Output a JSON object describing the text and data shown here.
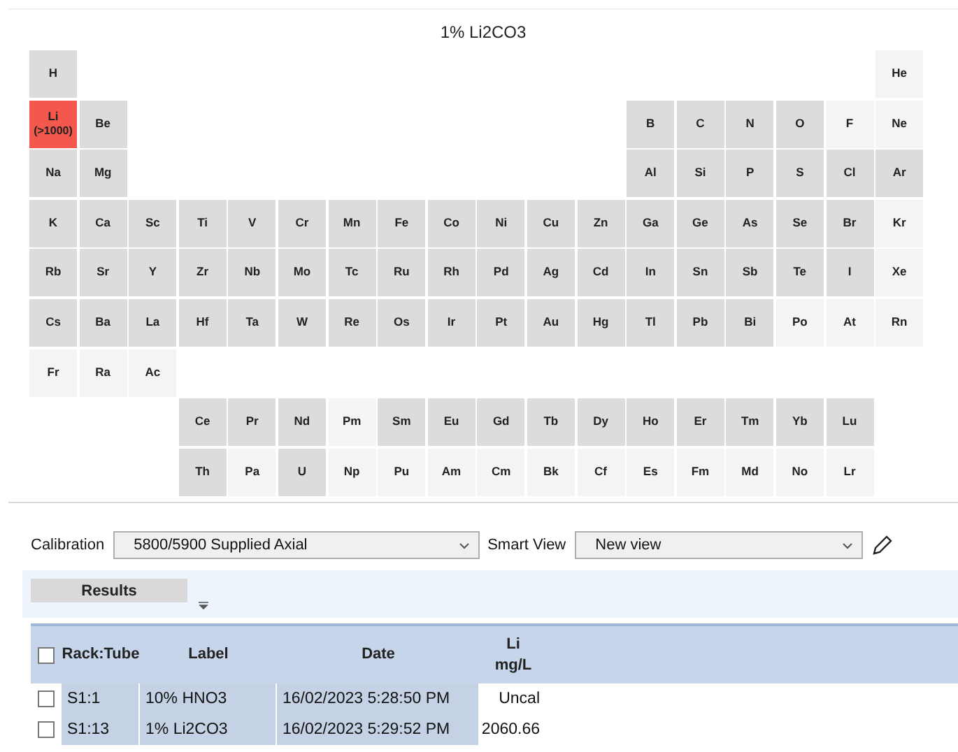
{
  "periodic_table": {
    "title": "1% Li2CO3",
    "elements": [
      {
        "symbol": "H",
        "color": "#dcdcdc"
      },
      {
        "symbol": "He",
        "color": "#f4f4f4"
      },
      {
        "symbol": "Li",
        "color": "#f4574b",
        "note": "(>1000)"
      },
      {
        "symbol": "Be",
        "color": "#dcdcdc"
      },
      {
        "symbol": "B",
        "color": "#dcdcdc"
      },
      {
        "symbol": "C",
        "color": "#dcdcdc"
      },
      {
        "symbol": "N",
        "color": "#dcdcdc"
      },
      {
        "symbol": "O",
        "color": "#dcdcdc"
      },
      {
        "symbol": "F",
        "color": "#f4f4f4"
      },
      {
        "symbol": "Ne",
        "color": "#f4f4f4"
      },
      {
        "symbol": "Na",
        "color": "#dcdcdc"
      },
      {
        "symbol": "Mg",
        "color": "#dcdcdc"
      },
      {
        "symbol": "Al",
        "color": "#dcdcdc"
      },
      {
        "symbol": "Si",
        "color": "#dcdcdc"
      },
      {
        "symbol": "P",
        "color": "#dcdcdc"
      },
      {
        "symbol": "S",
        "color": "#dcdcdc"
      },
      {
        "symbol": "Cl",
        "color": "#dcdcdc"
      },
      {
        "symbol": "Ar",
        "color": "#dcdcdc"
      },
      {
        "symbol": "K",
        "color": "#dcdcdc"
      },
      {
        "symbol": "Ca",
        "color": "#dcdcdc"
      },
      {
        "symbol": "Sc",
        "color": "#dcdcdc"
      },
      {
        "symbol": "Ti",
        "color": "#dcdcdc"
      },
      {
        "symbol": "V",
        "color": "#dcdcdc"
      },
      {
        "symbol": "Cr",
        "color": "#dcdcdc"
      },
      {
        "symbol": "Mn",
        "color": "#dcdcdc"
      },
      {
        "symbol": "Fe",
        "color": "#dcdcdc"
      },
      {
        "symbol": "Co",
        "color": "#dcdcdc"
      },
      {
        "symbol": "Ni",
        "color": "#dcdcdc"
      },
      {
        "symbol": "Cu",
        "color": "#dcdcdc"
      },
      {
        "symbol": "Zn",
        "color": "#dcdcdc"
      },
      {
        "symbol": "Ga",
        "color": "#dcdcdc"
      },
      {
        "symbol": "Ge",
        "color": "#dcdcdc"
      },
      {
        "symbol": "As",
        "color": "#dcdcdc"
      },
      {
        "symbol": "Se",
        "color": "#dcdcdc"
      },
      {
        "symbol": "Br",
        "color": "#dcdcdc"
      },
      {
        "symbol": "Kr",
        "color": "#f4f4f4"
      },
      {
        "symbol": "Rb",
        "color": "#dcdcdc"
      },
      {
        "symbol": "Sr",
        "color": "#dcdcdc"
      },
      {
        "symbol": "Y",
        "color": "#dcdcdc"
      },
      {
        "symbol": "Zr",
        "color": "#dcdcdc"
      },
      {
        "symbol": "Nb",
        "color": "#dcdcdc"
      },
      {
        "symbol": "Mo",
        "color": "#dcdcdc"
      },
      {
        "symbol": "Tc",
        "color": "#dcdcdc"
      },
      {
        "symbol": "Ru",
        "color": "#dcdcdc"
      },
      {
        "symbol": "Rh",
        "color": "#dcdcdc"
      },
      {
        "symbol": "Pd",
        "color": "#dcdcdc"
      },
      {
        "symbol": "Ag",
        "color": "#dcdcdc"
      },
      {
        "symbol": "Cd",
        "color": "#dcdcdc"
      },
      {
        "symbol": "In",
        "color": "#dcdcdc"
      },
      {
        "symbol": "Sn",
        "color": "#dcdcdc"
      },
      {
        "symbol": "Sb",
        "color": "#dcdcdc"
      },
      {
        "symbol": "Te",
        "color": "#dcdcdc"
      },
      {
        "symbol": "I",
        "color": "#dcdcdc"
      },
      {
        "symbol": "Xe",
        "color": "#f4f4f4"
      },
      {
        "symbol": "Cs",
        "color": "#dcdcdc"
      },
      {
        "symbol": "Ba",
        "color": "#dcdcdc"
      },
      {
        "symbol": "La",
        "color": "#dcdcdc"
      },
      {
        "symbol": "Hf",
        "color": "#dcdcdc"
      },
      {
        "symbol": "Ta",
        "color": "#dcdcdc"
      },
      {
        "symbol": "W",
        "color": "#dcdcdc"
      },
      {
        "symbol": "Re",
        "color": "#dcdcdc"
      },
      {
        "symbol": "Os",
        "color": "#dcdcdc"
      },
      {
        "symbol": "Ir",
        "color": "#dcdcdc"
      },
      {
        "symbol": "Pt",
        "color": "#dcdcdc"
      },
      {
        "symbol": "Au",
        "color": "#dcdcdc"
      },
      {
        "symbol": "Hg",
        "color": "#dcdcdc"
      },
      {
        "symbol": "Tl",
        "color": "#dcdcdc"
      },
      {
        "symbol": "Pb",
        "color": "#dcdcdc"
      },
      {
        "symbol": "Bi",
        "color": "#dcdcdc"
      },
      {
        "symbol": "Po",
        "color": "#f4f4f4"
      },
      {
        "symbol": "At",
        "color": "#f4f4f4"
      },
      {
        "symbol": "Rn",
        "color": "#f4f4f4"
      },
      {
        "symbol": "Fr",
        "color": "#f4f4f4"
      },
      {
        "symbol": "Ra",
        "color": "#f4f4f4"
      },
      {
        "symbol": "Ac",
        "color": "#f4f4f4"
      },
      {
        "symbol": "Ce",
        "color": "#dcdcdc"
      },
      {
        "symbol": "Pr",
        "color": "#dcdcdc"
      },
      {
        "symbol": "Nd",
        "color": "#dcdcdc"
      },
      {
        "symbol": "Pm",
        "color": "#f4f4f4"
      },
      {
        "symbol": "Sm",
        "color": "#dcdcdc"
      },
      {
        "symbol": "Eu",
        "color": "#dcdcdc"
      },
      {
        "symbol": "Gd",
        "color": "#dcdcdc"
      },
      {
        "symbol": "Tb",
        "color": "#dcdcdc"
      },
      {
        "symbol": "Dy",
        "color": "#dcdcdc"
      },
      {
        "symbol": "Ho",
        "color": "#dcdcdc"
      },
      {
        "symbol": "Er",
        "color": "#dcdcdc"
      },
      {
        "symbol": "Tm",
        "color": "#dcdcdc"
      },
      {
        "symbol": "Yb",
        "color": "#dcdcdc"
      },
      {
        "symbol": "Lu",
        "color": "#dcdcdc"
      },
      {
        "symbol": "Th",
        "color": "#dcdcdc"
      },
      {
        "symbol": "Pa",
        "color": "#f4f4f4"
      },
      {
        "symbol": "U",
        "color": "#dcdcdc"
      },
      {
        "symbol": "Np",
        "color": "#f4f4f4"
      },
      {
        "symbol": "Pu",
        "color": "#f4f4f4"
      },
      {
        "symbol": "Am",
        "color": "#f4f4f4"
      },
      {
        "symbol": "Cm",
        "color": "#f4f4f4"
      },
      {
        "symbol": "Bk",
        "color": "#f4f4f4"
      },
      {
        "symbol": "Cf",
        "color": "#f4f4f4"
      },
      {
        "symbol": "Es",
        "color": "#f4f4f4"
      },
      {
        "symbol": "Fm",
        "color": "#f4f4f4"
      },
      {
        "symbol": "Md",
        "color": "#f4f4f4"
      },
      {
        "symbol": "No",
        "color": "#f4f4f4"
      },
      {
        "symbol": "Lr",
        "color": "#f4f4f4"
      }
    ]
  },
  "controls": {
    "calibration_label": "Calibration",
    "calibration_value": "5800/5900 Supplied Axial",
    "smart_view_label": "Smart View",
    "smart_view_value": "New view"
  },
  "results_tab": {
    "label": "Results",
    "selected": true
  },
  "table": {
    "columns": [
      {
        "label": "Rack:Tube"
      },
      {
        "label": "Label"
      },
      {
        "label": "Date"
      },
      {
        "label": "Li",
        "unit": "mg/L"
      }
    ],
    "header_checked": false,
    "rows": [
      {
        "checked": false,
        "cells": [
          "S1:1",
          "10% HNO3",
          "16/02/2023 5:28:50 PM",
          "Uncal"
        ]
      },
      {
        "checked": false,
        "cells": [
          "S1:13",
          "1% Li2CO3",
          "16/02/2023 5:29:52 PM",
          "2060.66"
        ]
      }
    ]
  }
}
